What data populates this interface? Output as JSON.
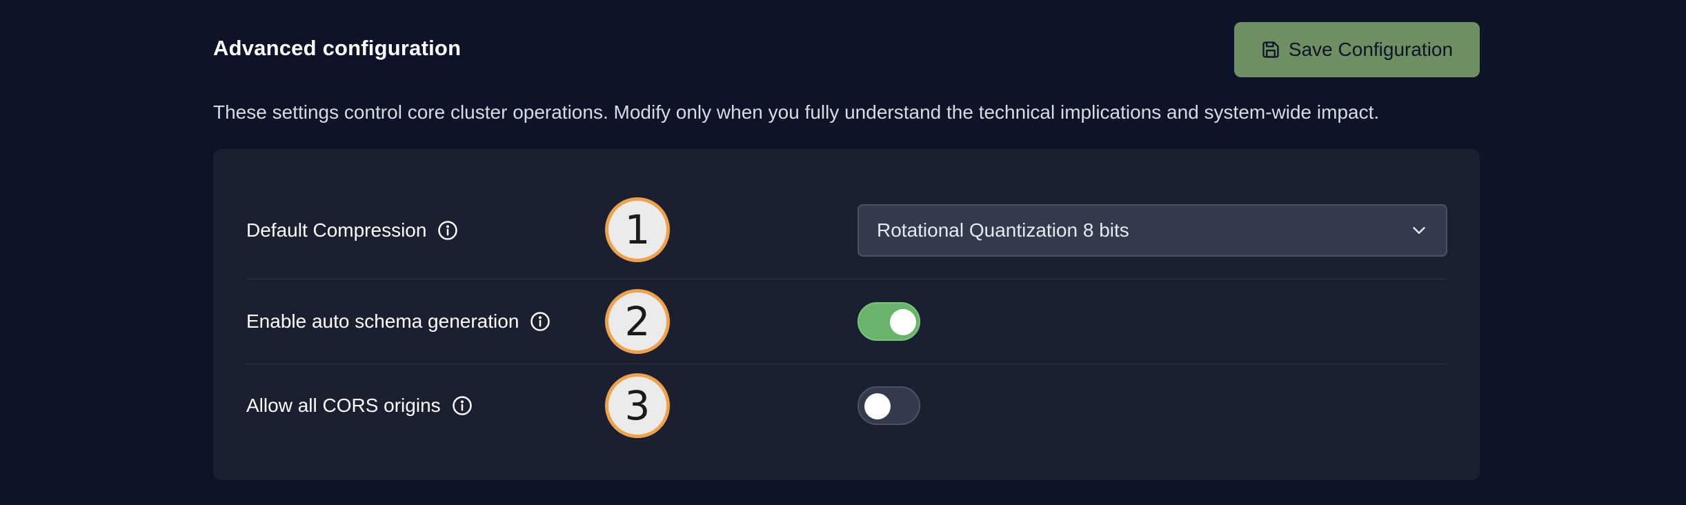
{
  "header": {
    "title": "Advanced configuration",
    "save_label": "Save Configuration",
    "save_color": "#6f8f62"
  },
  "description": "These settings control core cluster operations. Modify only when you fully understand the technical implications and system-wide impact.",
  "settings": [
    {
      "label": "Default Compression",
      "badge": "1",
      "control": "dropdown",
      "value": "Rotational Quantization 8 bits"
    },
    {
      "label": "Enable auto schema generation",
      "badge": "2",
      "control": "toggle",
      "enabled": true
    },
    {
      "label": "Allow all CORS origins",
      "badge": "3",
      "control": "toggle",
      "enabled": false
    }
  ],
  "icons": {
    "save": "floppy-disk-icon",
    "info": "info-circle-icon",
    "dropdown": "chevron-down-icon"
  },
  "colors": {
    "background": "#0d1427",
    "panel": "#1a2030",
    "toggle_on": "#6ab36a",
    "badge_border": "#f0a24a"
  }
}
